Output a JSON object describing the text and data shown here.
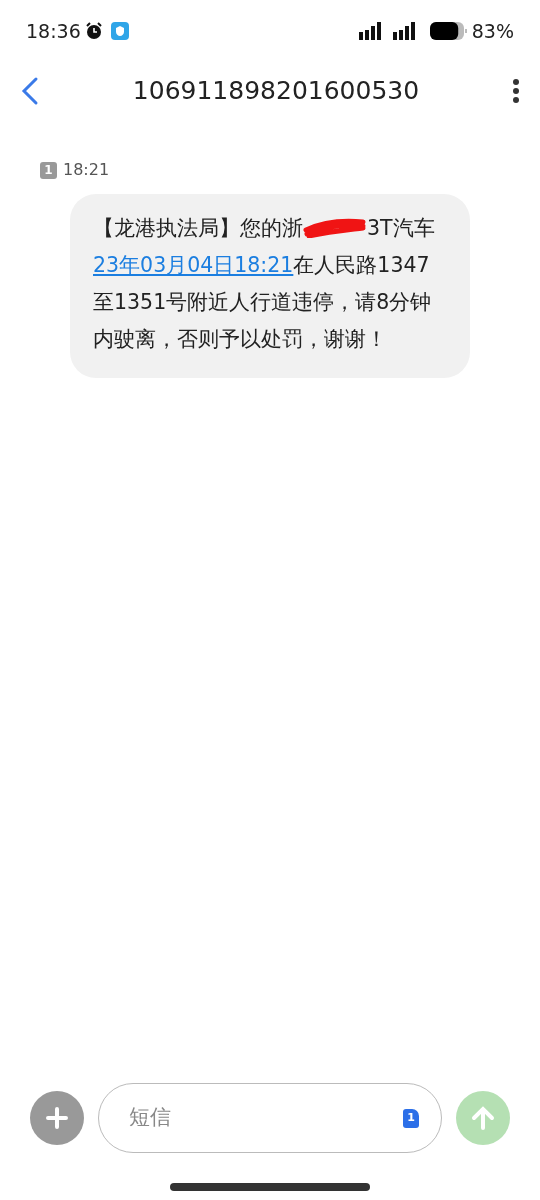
{
  "status_bar": {
    "time": "18:36",
    "battery": "83%"
  },
  "header": {
    "title": "106911898201600530"
  },
  "messages": [
    {
      "sim": "1",
      "time": "18:21",
      "parts": [
        {
          "kind": "text",
          "text": "【龙港执法局】您的浙"
        },
        {
          "kind": "redacted"
        },
        {
          "kind": "text",
          "text": "3T汽车"
        },
        {
          "kind": "link",
          "text": "23年03月04日18:21"
        },
        {
          "kind": "text",
          "text": "在人民路1347至1351号附近人行道违停，请8分钟内驶离，否则予以处罚，谢谢！"
        }
      ]
    }
  ],
  "composer": {
    "placeholder": "短信",
    "sim": "1"
  }
}
